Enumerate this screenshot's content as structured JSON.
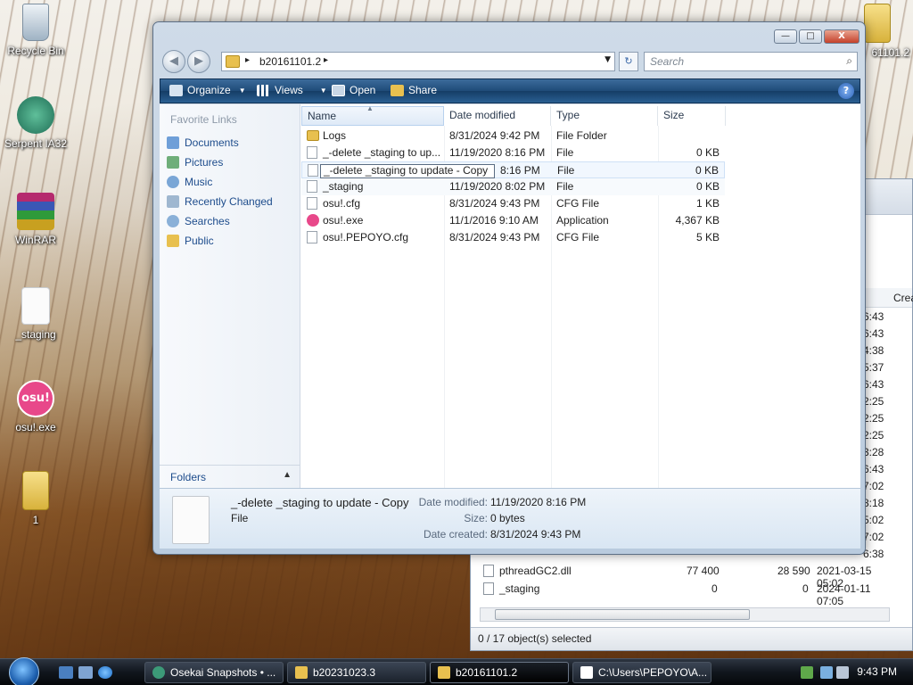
{
  "desktop": {
    "icons": [
      {
        "label": "Recycle Bin"
      },
      {
        "label": "Serpent IA32"
      },
      {
        "label": "WinRAR"
      },
      {
        "label": "_staging"
      },
      {
        "label": "osu!.exe",
        "glyph": "osu!"
      },
      {
        "label": "1"
      }
    ],
    "top_right_label": "61101.2"
  },
  "background_window": {
    "column_fragment": "Crea",
    "time_fragments": [
      "6:43",
      "6:43",
      "4:38",
      "5:37",
      "6:43",
      "2:25",
      "2:25",
      "2:25",
      "3:28",
      "6:43",
      "7:02",
      "8:18",
      "5:02",
      "7:02",
      "6:38"
    ],
    "rows": [
      {
        "name": "pthreadGC2.dll",
        "size": "77 400",
        "packed": "28 590",
        "modified": "2021-03-15 05:02"
      },
      {
        "name": "_staging",
        "size": "0",
        "packed": "0",
        "modified": "2024-01-11 07:05"
      }
    ],
    "status": "0 / 17 object(s) selected"
  },
  "explorer": {
    "caption": {
      "minimize": "—",
      "maximize": "□",
      "close": "X"
    },
    "address": {
      "crumb": "b20161101.2"
    },
    "search": {
      "placeholder": "Search"
    },
    "toolbar": {
      "organize": "Organize",
      "views": "Views",
      "open": "Open",
      "share": "Share",
      "help": "?"
    },
    "nav": {
      "heading": "Favorite Links",
      "links": [
        "Documents",
        "Pictures",
        "Music",
        "Recently Changed",
        "Searches",
        "Public"
      ],
      "folders": "Folders"
    },
    "columns": {
      "name": "Name",
      "date": "Date modified",
      "type": "Type",
      "size": "Size"
    },
    "files": [
      {
        "name": "Logs",
        "date": "8/31/2024 9:42 PM",
        "type": "File Folder",
        "size": "",
        "icon": "folder"
      },
      {
        "name": "_-delete _staging to up...",
        "date": "11/19/2020 8:16 PM",
        "type": "File",
        "size": "0 KB",
        "icon": "file"
      },
      {
        "name": "_-delete _staging to update - Copy",
        "date": "8:16 PM",
        "type": "File",
        "size": "0 KB",
        "icon": "file"
      },
      {
        "name": "_staging",
        "date": "11/19/2020 8:02 PM",
        "type": "File",
        "size": "0 KB",
        "icon": "file"
      },
      {
        "name": "osu!.cfg",
        "date": "8/31/2024 9:43 PM",
        "type": "CFG File",
        "size": "1 KB",
        "icon": "file"
      },
      {
        "name": "osu!.exe",
        "date": "11/1/2016 9:10 AM",
        "type": "Application",
        "size": "4,367 KB",
        "icon": "osu"
      },
      {
        "name": "osu!.PEPOYO.cfg",
        "date": "8/31/2024 9:43 PM",
        "type": "CFG File",
        "size": "5 KB",
        "icon": "file"
      }
    ],
    "details": {
      "name": "_-delete _staging to update - Copy",
      "kind": "File",
      "modified_label": "Date modified:",
      "modified": "11/19/2020 8:16 PM",
      "size_label": "Size:",
      "size": "0 bytes",
      "created_label": "Date created:",
      "created": "8/31/2024 9:43 PM"
    }
  },
  "taskbar": {
    "tasks": [
      "Osekai Snapshots • ...",
      "b20231023.3",
      "b20161101.2",
      "C:\\Users\\PEPOYO\\A..."
    ],
    "clock": "9:43 PM"
  },
  "colors": {
    "accent": "#1d4c8c",
    "toolbar": "#1f4b78",
    "osu": "#e8488a"
  }
}
